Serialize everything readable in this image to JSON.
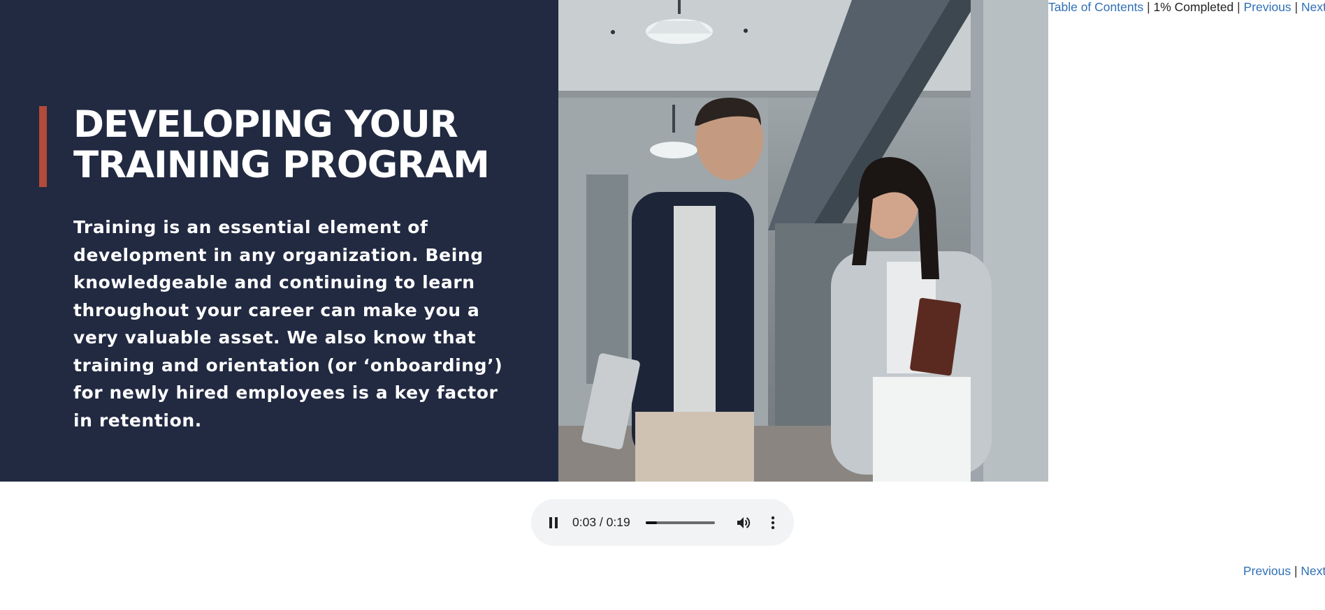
{
  "slide": {
    "title_line1": "DEVELOPING YOUR",
    "title_line2": "TRAINING PROGRAM",
    "body": "Training is an essential element of development in any organization. Being knowledgeable and continuing to learn throughout your career can make you a very valuable asset. We also know that training and orientation (or ‘onboarding’) for newly hired employees is a key factor in retention.",
    "panel_color": "#222a42",
    "accent_color": "#b34a3a",
    "photo_icon": "office-people-photo"
  },
  "top_nav": {
    "toc": "Table of Contents",
    "separator": "|",
    "progress_text": "1% Completed",
    "previous": "Previous",
    "next": "Next"
  },
  "bottom_nav": {
    "previous": "Previous",
    "separator": "|",
    "next": "Next"
  },
  "audio": {
    "time": "0:03 / 0:19",
    "progress_fraction": 0.16,
    "play_state_icon": "pause-icon",
    "volume_icon": "volume-icon",
    "menu_icon": "more-vert-icon"
  },
  "colors": {
    "link": "#2f6fb5"
  }
}
